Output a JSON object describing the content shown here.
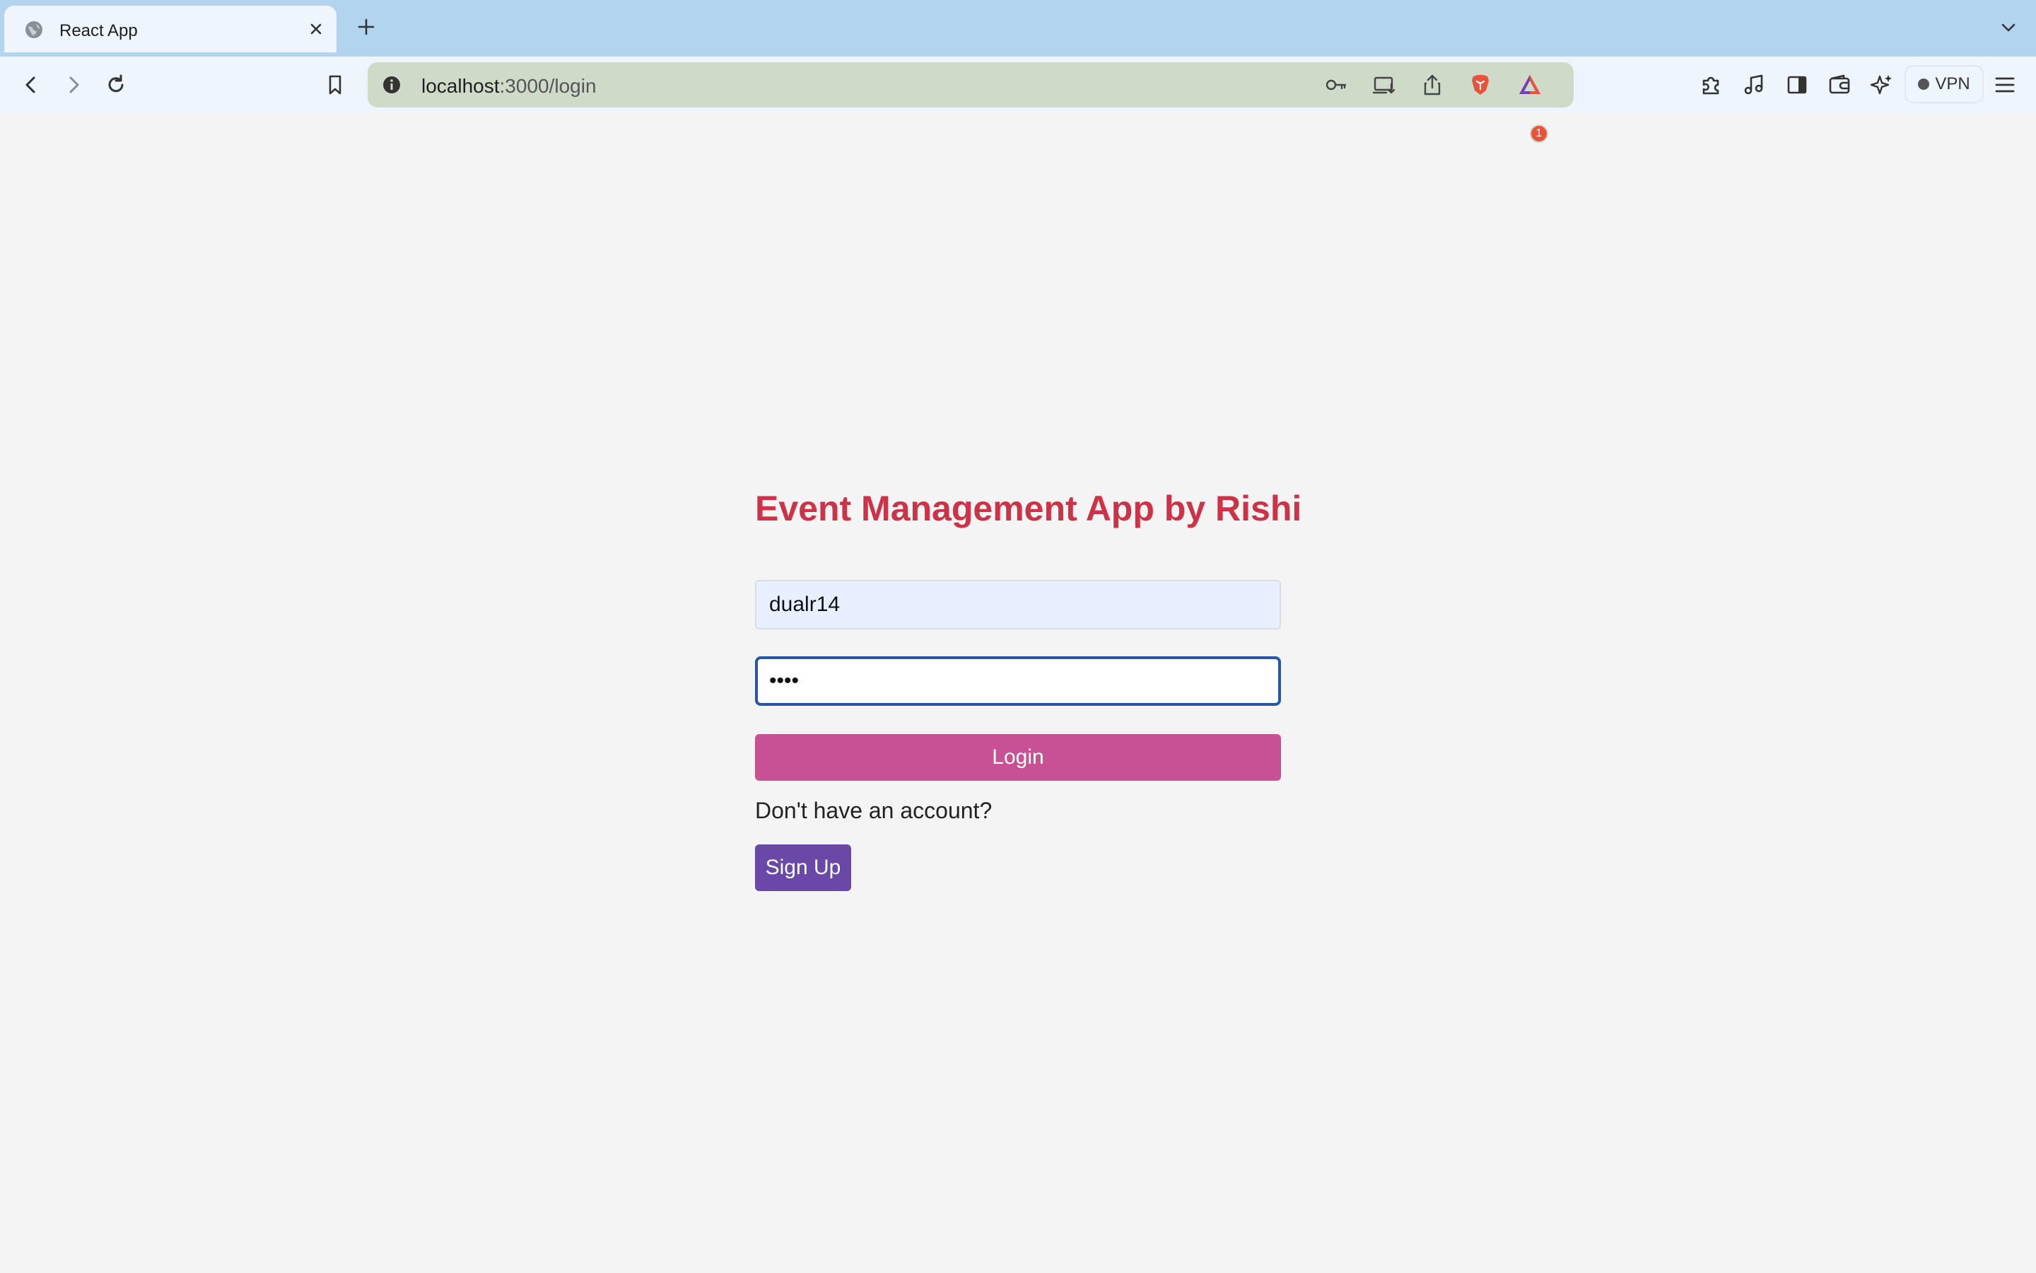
{
  "browser": {
    "tab": {
      "title": "React App",
      "favicon": "globe-icon"
    },
    "address_bar": {
      "host": "localhost",
      "path": ":3000/login"
    },
    "rewards_badge_count": "1",
    "vpn_label": "VPN",
    "colors": {
      "tabstrip_bg": "#b3d4ee",
      "toolbar_bg": "#eef5fc",
      "omnibox_bg": "#cfdac8"
    }
  },
  "page": {
    "title": "Event Management App by Rishi",
    "username_value": "dualr14",
    "password_value": "1234",
    "login_label": "Login",
    "no_account_text": "Don't have an account?",
    "signup_label": "Sign Up",
    "colors": {
      "title": "#cd3347",
      "login_button": "#c85193",
      "signup_button": "#6a48a8",
      "focus_border": "#2a54a7",
      "background": "#f4f4f4"
    }
  }
}
